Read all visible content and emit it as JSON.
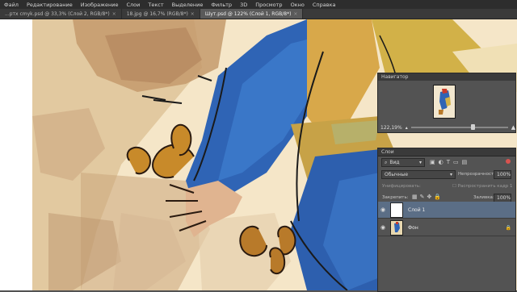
{
  "menubar": {
    "items": [
      "Файл",
      "Редактирование",
      "Изображение",
      "Слои",
      "Текст",
      "Выделение",
      "Фильтр",
      "3D",
      "Просмотр",
      "Окно",
      "Справка"
    ]
  },
  "tabs": [
    {
      "label": "...ртх cmyk.psd @ 33,3% (Слой 2, RGB/8*)"
    },
    {
      "label": "18.jpg @ 16,7% (RGB/8*)"
    },
    {
      "label": "Шут.psd @ 122% (Слой 1, RGB/8*)"
    }
  ],
  "navigator": {
    "title": "Навигатор",
    "zoom": "122,19%"
  },
  "layers": {
    "title": "Слои",
    "kind_filter": "Вид",
    "blend_mode": "Обычные",
    "opacity_label": "Непрозрачность:",
    "opacity_value": "100%",
    "unify_label": "Унифицировать:",
    "propagate_label": "Распространить кадр 1",
    "lock_label": "Закрепить:",
    "fill_label": "Заливка:",
    "fill_value": "100%",
    "items": [
      {
        "name": "Слой 1",
        "selected": true
      },
      {
        "name": "Фон",
        "selected": false,
        "locked": true
      }
    ]
  },
  "colors": {
    "accent_selected": "#5b6e86",
    "panel_bg": "#535353"
  }
}
